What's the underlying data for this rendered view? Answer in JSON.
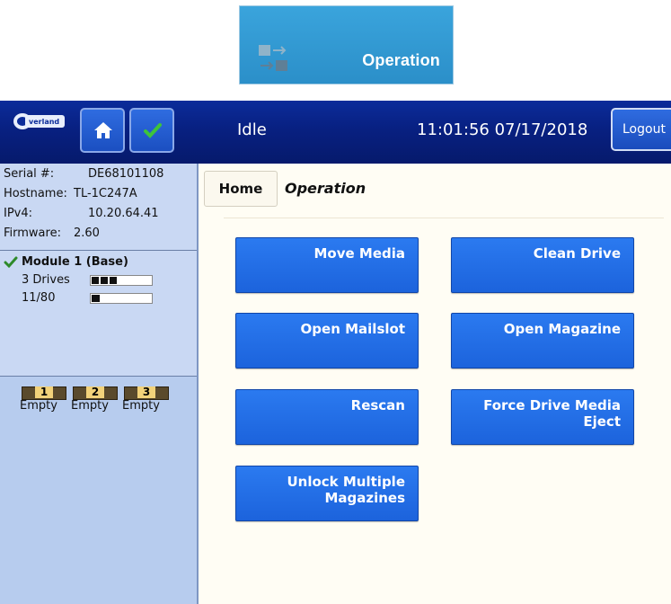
{
  "top_tile": {
    "label": "Operation",
    "icon": "operation-arrows-icon"
  },
  "header": {
    "logo_text": "Overland Storage",
    "home_icon": "home-icon",
    "check_icon": "checkmark-icon",
    "status": "Idle",
    "clock": "11:01:56  07/17/2018",
    "logout_label": "Logout"
  },
  "info": {
    "serial_label": "Serial #:",
    "serial_value": "DE68101108",
    "hostname_label": "Hostname:",
    "hostname_value": "TL-1C247A",
    "ipv4_label": "IPv4:",
    "ipv4_value": "10.20.64.41",
    "firmware_label": "Firmware:",
    "firmware_value": "2.60"
  },
  "module": {
    "title": "Module 1 (Base)",
    "drives_label": "3 Drives",
    "drives_filled": 3,
    "slots_label": "11/80",
    "slots_fill_fraction": 0.1375,
    "slots": [
      {
        "number": "1",
        "label": "Empty"
      },
      {
        "number": "2",
        "label": "Empty"
      },
      {
        "number": "3",
        "label": "Empty"
      }
    ]
  },
  "breadcrumb": {
    "home": "Home",
    "current": "Operation"
  },
  "buttons": {
    "move_media": "Move Media",
    "clean_drive": "Clean Drive",
    "open_mailslot": "Open Mailslot",
    "open_magazine": "Open Magazine",
    "rescan": "Rescan",
    "force_eject": "Force Drive Media Eject",
    "unlock_magazines": "Unlock Multiple Magazines"
  },
  "colors": {
    "header_blue": "#082081",
    "button_blue": "#1f6be3",
    "sidebar_bg": "#b7ccee",
    "tile_blue": "#2b95d0"
  }
}
